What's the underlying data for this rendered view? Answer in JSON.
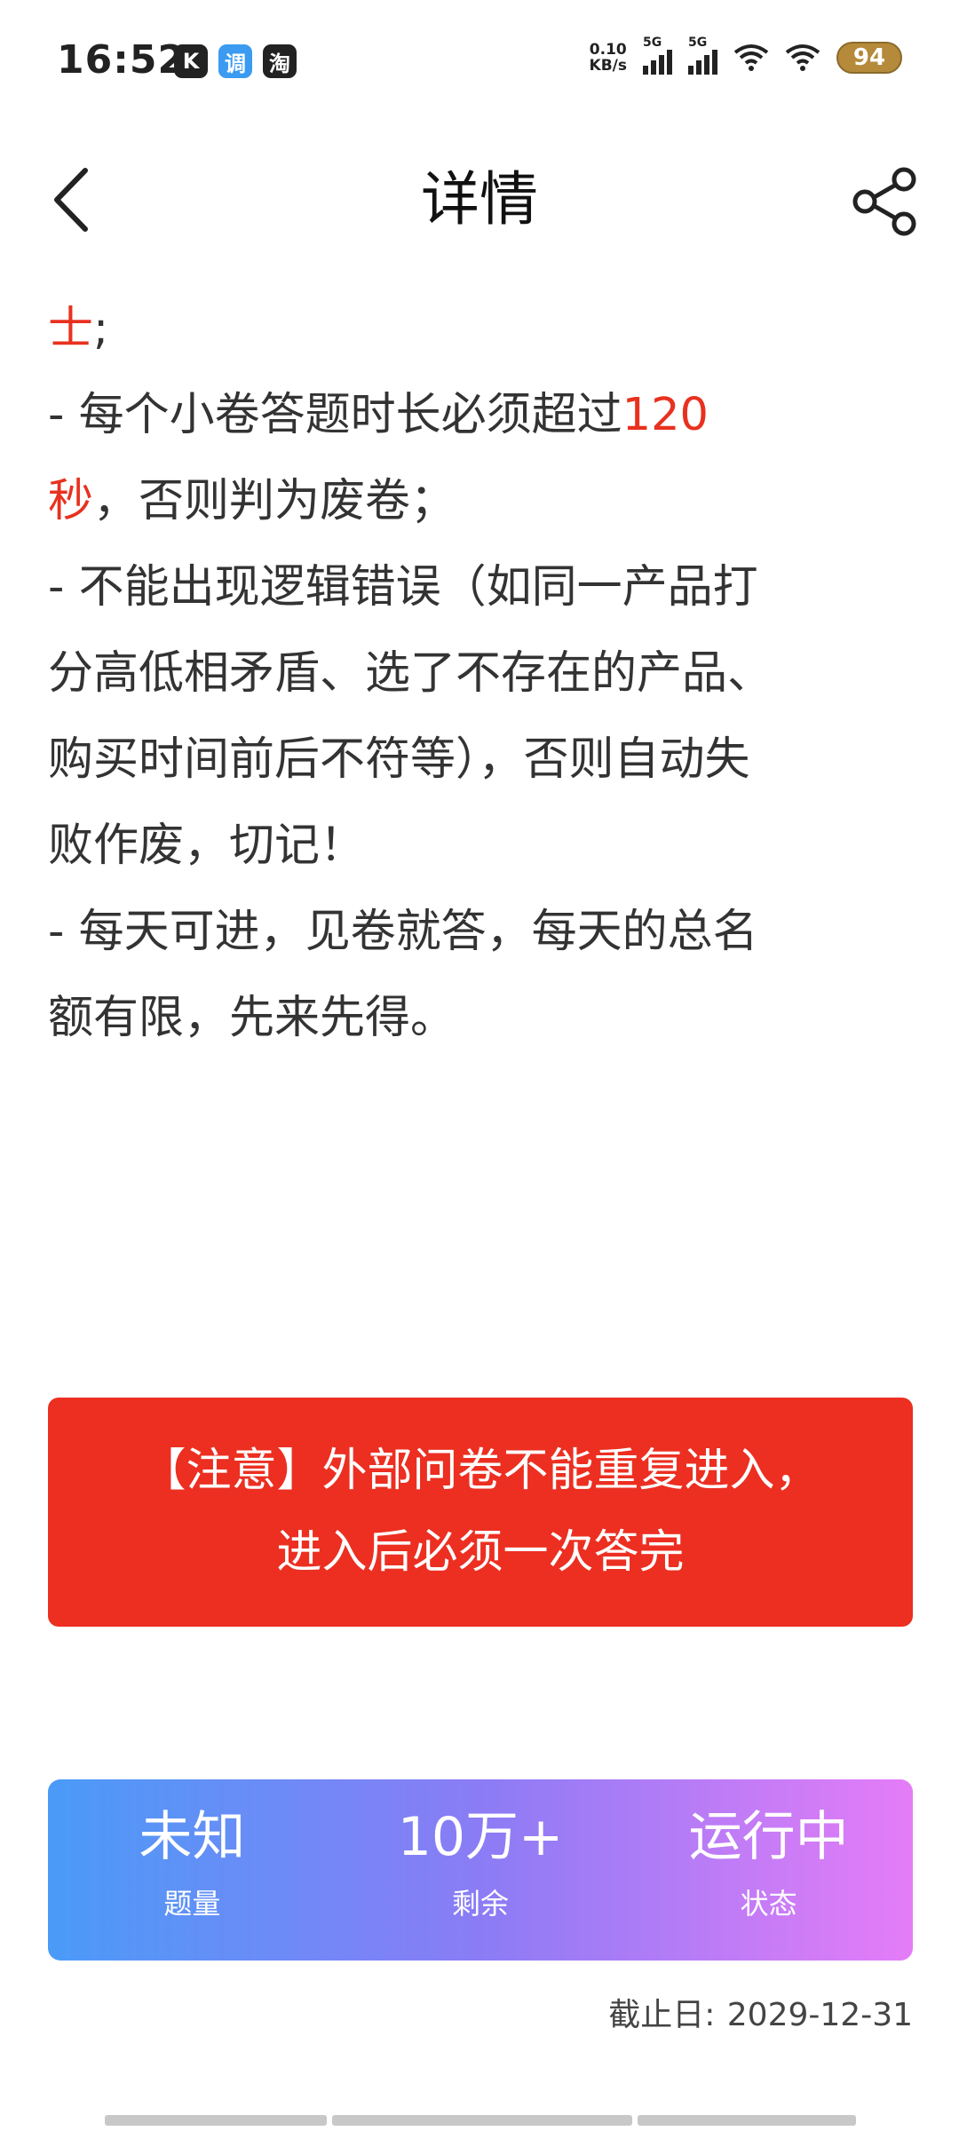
{
  "status_bar": {
    "time": "16:52",
    "app_icons": [
      {
        "label": "K",
        "color": "#222222"
      },
      {
        "label": "调",
        "color": "#3a9bf0"
      },
      {
        "label": "淘",
        "color": "#222222"
      }
    ],
    "net_speed_value": "0.10",
    "net_speed_unit": "KB/s",
    "sim1": "5G",
    "sim2": "5G",
    "battery": "94"
  },
  "nav": {
    "title": "详情",
    "back_icon": "chevron-left-icon",
    "share_icon": "share-icon"
  },
  "content": {
    "l1_red": "士",
    "l1_rest": ";",
    "l2_text": "- 每个小卷答题时长必须超过",
    "l2_red": "120",
    "l3_red": "秒",
    "l3_rest": "，否则判为废卷；",
    "l4": "- 不能出现逻辑错误（如同一产品打",
    "l5": "分高低相矛盾、选了不存在的产品、",
    "l6": "购买时间前后不符等），否则自动失",
    "l7": "败作废，切记！",
    "l8": "- 每天可进，见卷就答，每天的总名",
    "l9": "额有限，先来先得。"
  },
  "notice": {
    "line1": "【注意】外部问卷不能重复进入，",
    "line2": "进入后必须一次答完",
    "bg_color": "#ec2f21"
  },
  "stats": [
    {
      "value": "未知",
      "label": "题量"
    },
    {
      "value": "10万+",
      "label": "剩余"
    },
    {
      "value": "运行中",
      "label": "状态"
    }
  ],
  "deadline": {
    "label": "截止日:",
    "date": "2029-12-31"
  },
  "colors": {
    "accent_red": "#e8311f",
    "gradient_start": "#4a9bf7",
    "gradient_end": "#e57cf7"
  }
}
